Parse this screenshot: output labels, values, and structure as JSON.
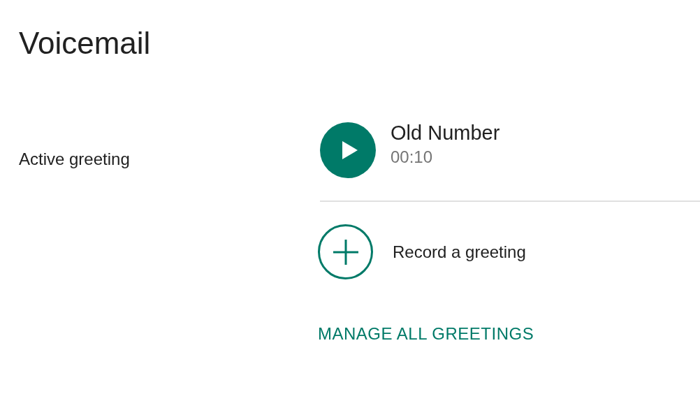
{
  "title": "Voicemail",
  "section": {
    "label": "Active greeting",
    "greeting": {
      "name": "Old Number",
      "duration": "00:10"
    },
    "record_action": {
      "label": "Record a greeting"
    },
    "manage_link": {
      "label": "MANAGE ALL GREETINGS"
    }
  }
}
